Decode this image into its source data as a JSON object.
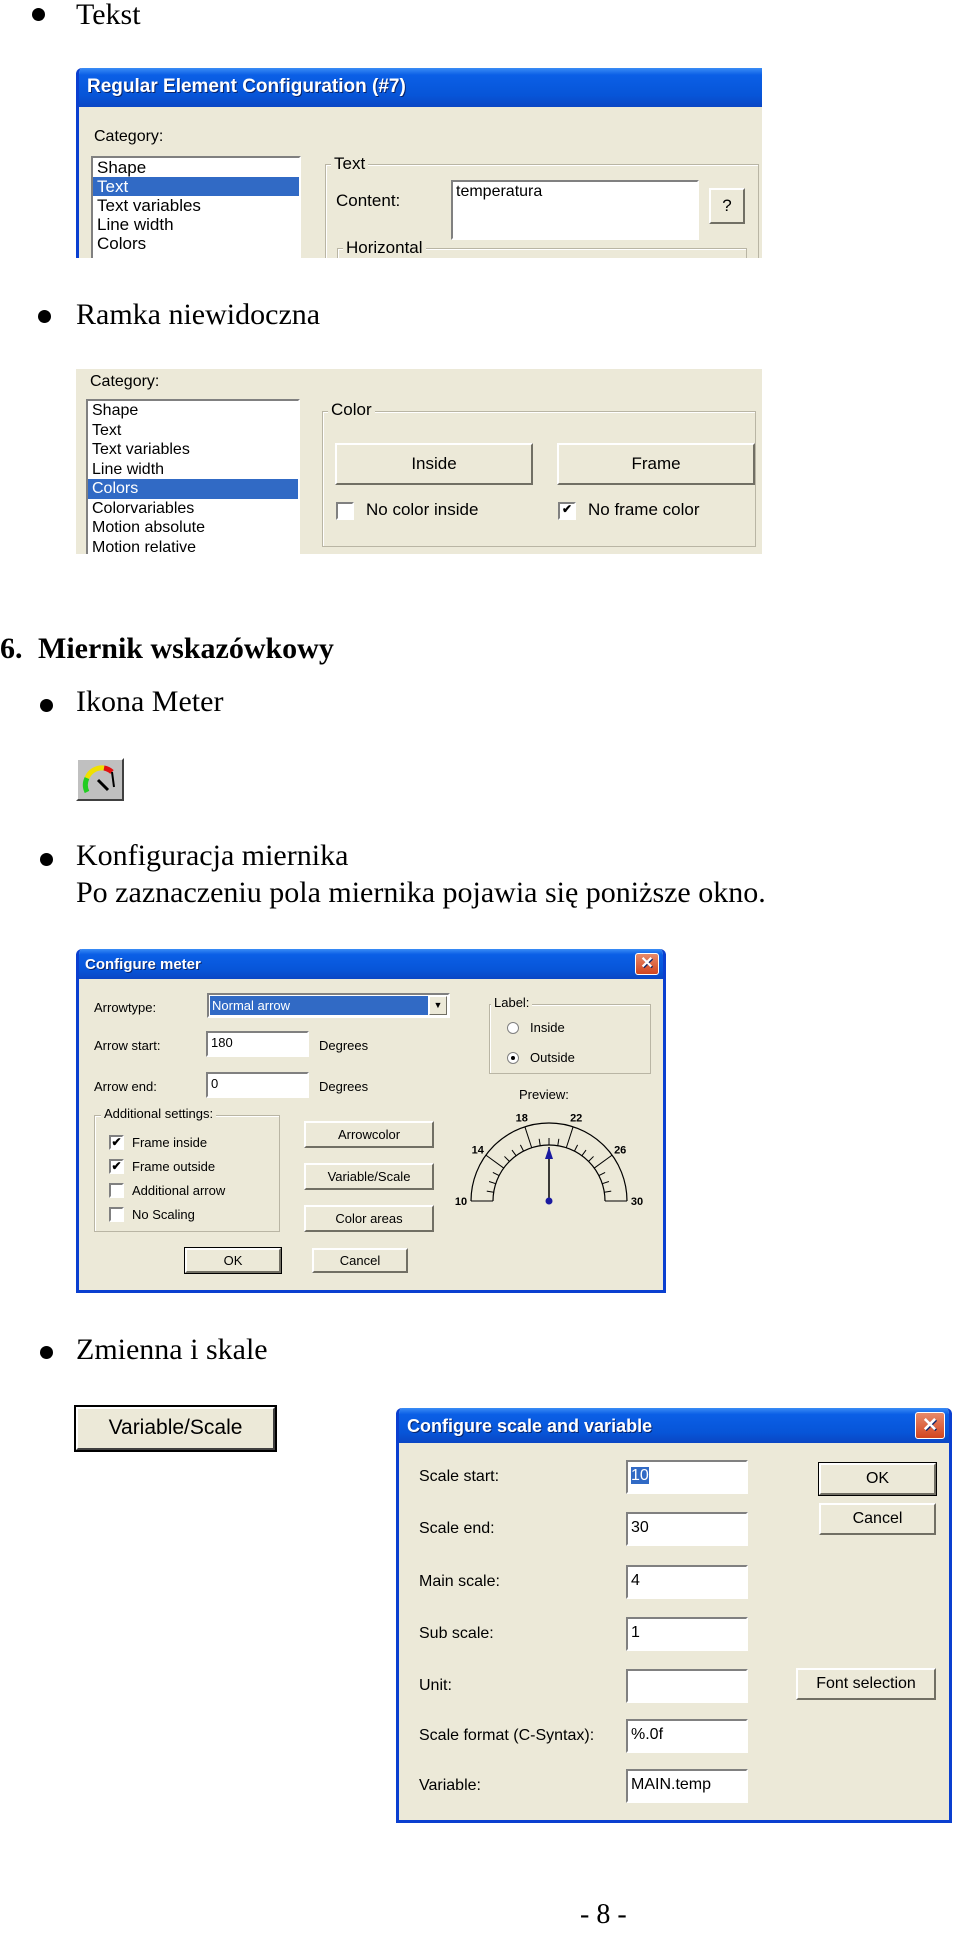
{
  "sections": {
    "tekst": {
      "bullet": "Tekst"
    },
    "ramka": {
      "bullet": "Ramka niewidoczna"
    },
    "heading": {
      "number": "6.",
      "title": "Miernik wskazówkowy"
    },
    "ikona": {
      "bullet": "Ikona Meter"
    },
    "konfiguracja": {
      "bullet": "Konfiguracja miernika",
      "text": "Po zaznaczeniu pola miernika pojawia się poniższe okno."
    },
    "zmienna": {
      "bullet": "Zmienna i skale"
    }
  },
  "dialog_text": {
    "title": "Regular Element Configuration (#7)",
    "category_label": "Category:",
    "categories": [
      "Shape",
      "Text",
      "Text variables",
      "Line width",
      "Colors"
    ],
    "selected_category": "Text",
    "group_text": "Text",
    "content_label": "Content:",
    "content_value": "temperatura",
    "help_button": "?",
    "group_horizontal": "Horizontal"
  },
  "dialog_colors": {
    "category_label": "Category:",
    "categories": [
      "Shape",
      "Text",
      "Text variables",
      "Line width",
      "Colors",
      "Colorvariables",
      "Motion absolute",
      "Motion relative"
    ],
    "selected_category": "Colors",
    "group_color": "Color",
    "inside_button": "Inside",
    "frame_button": "Frame",
    "no_color_inside": {
      "label": "No color inside",
      "checked": false
    },
    "no_frame_color": {
      "label": "No frame color",
      "checked": true
    }
  },
  "meter_icon": {
    "icon": "meter-gauge-icon"
  },
  "configure_meter": {
    "title": "Configure meter",
    "arrowtype_label": "Arrowtype:",
    "arrowtype_value": "Normal arrow",
    "arrow_start_label": "Arrow start:",
    "arrow_start_value": "180",
    "arrow_end_label": "Arrow end:",
    "arrow_end_value": "0",
    "degrees": "Degrees",
    "label_group": "Label:",
    "label_inside": {
      "label": "Inside",
      "selected": false
    },
    "label_outside": {
      "label": "Outside",
      "selected": true
    },
    "preview_label": "Preview:",
    "preview_scale": {
      "start": 10,
      "end": 30,
      "main_step": 4,
      "labels": [
        "10",
        "14",
        "18",
        "22",
        "26",
        "30"
      ],
      "arrow_value": 20
    },
    "additional_group": "Additional settings:",
    "checks": [
      {
        "label": "Frame inside",
        "checked": true
      },
      {
        "label": "Frame outside",
        "checked": true
      },
      {
        "label": "Additional arrow",
        "checked": false
      },
      {
        "label": "No Scaling",
        "checked": false
      }
    ],
    "arrowcolor_button": "Arrowcolor",
    "variable_scale_button": "Variable/Scale",
    "color_areas_button": "Color areas",
    "ok_button": "OK",
    "cancel_button": "Cancel"
  },
  "variable_scale_button": "Variable/Scale",
  "configure_scale": {
    "title": "Configure scale and variable",
    "fields": [
      {
        "label": "Scale start:",
        "value": "10"
      },
      {
        "label": "Scale end:",
        "value": "30"
      },
      {
        "label": "Main scale:",
        "value": "4"
      },
      {
        "label": "Sub scale:",
        "value": "1"
      },
      {
        "label": "Unit:",
        "value": ""
      },
      {
        "label": "Scale format (C-Syntax):",
        "value": "%.0f"
      },
      {
        "label": "Variable:",
        "value": "MAIN.temp"
      }
    ],
    "ok_button": "OK",
    "cancel_button": "Cancel",
    "font_selection_button": "Font selection"
  },
  "page_number": "- 8 -",
  "colors": {
    "titlebar": "#0755d8",
    "selection": "#316ac5",
    "dialog_bg": "#ece9d8",
    "arrow": "#1a1aa0"
  }
}
